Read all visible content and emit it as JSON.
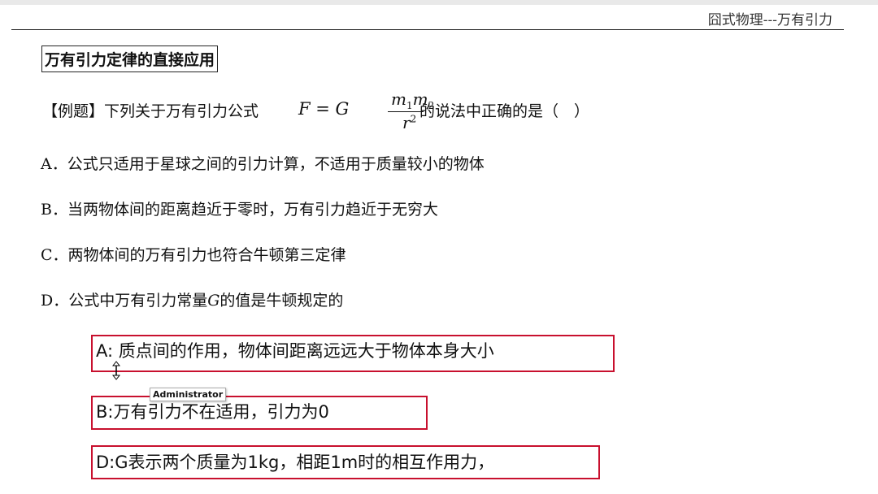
{
  "header": {
    "title": "囧式物理---万有引力"
  },
  "section": {
    "title": "万有引力定律的直接应用"
  },
  "question": {
    "lead": "【例题】下列关于万有引力公式",
    "formula": {
      "lhs": "F = G",
      "m": "m",
      "sub1": "1",
      "sub2": "2",
      "den": "r",
      "sup": "2"
    },
    "after": "的说法中正确的是（　）"
  },
  "options": [
    {
      "label": "A．公式只适用于星球之间的引力计算，不适用于质量较小的物体"
    },
    {
      "label": "B．当两物体间的距离趋近于零时，万有引力趋近于无穷大"
    },
    {
      "label": "C．两物体间的万有引力也符合牛顿第三定律"
    },
    {
      "pre": "D．公式中万有引力常量",
      "var": "G",
      "post": "的值是牛顿规定的"
    }
  ],
  "notes": [
    {
      "text": "A: 质点间的作用，物体间距离远远大于物体本身大小"
    },
    {
      "text": "B:万有引力不在适用，引力为0"
    },
    {
      "text": "D:G表示两个质量为1kg，相距1m时的相互作用力，"
    }
  ],
  "tooltip": {
    "text": "Administrator"
  },
  "colors": {
    "annotation_border": "#c8102e"
  }
}
